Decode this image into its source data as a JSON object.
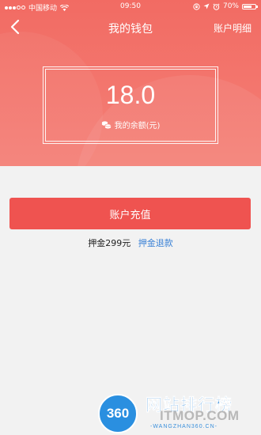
{
  "status_bar": {
    "carrier": "中国移动",
    "time": "09:50",
    "battery_percent": "70%",
    "battery_level": 0.7,
    "icons": [
      "signal-icon",
      "wifi-icon",
      "lock-rotation-icon",
      "location-icon",
      "alarm-icon",
      "battery-icon"
    ]
  },
  "nav": {
    "title": "我的钱包",
    "right_label": "账户明细",
    "back_icon": "chevron-left-icon"
  },
  "balance": {
    "amount": "18.0",
    "label": "我的余额(元)",
    "icon": "coins-icon"
  },
  "actions": {
    "recharge_label": "账户充值"
  },
  "deposit": {
    "text": "押金299元",
    "refund_link": "押金退款"
  },
  "watermark": {
    "logo": "360",
    "title": "网站排行榜",
    "site": "ITMOP.COM",
    "url": "-WANGZHAN360.CN-"
  },
  "colors": {
    "header_gradient_start": "#f26b63",
    "header_gradient_end": "#f48077",
    "recharge_button": "#ef5350",
    "link": "#3b82d6",
    "background": "#f2f2f2"
  }
}
